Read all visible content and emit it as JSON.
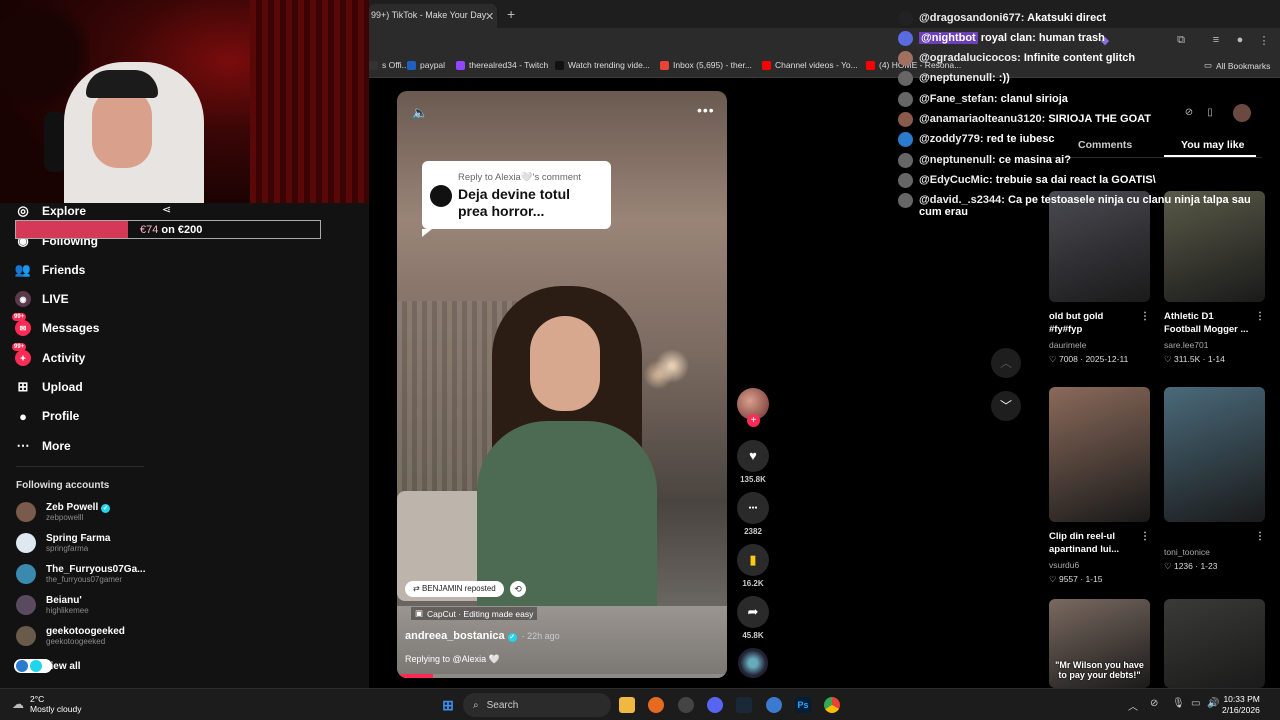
{
  "browser": {
    "tab_title": "99+) TikTok - Make Your Day",
    "tab_close": "✕",
    "new_tab": "+",
    "bookmarks": [
      {
        "label": "s Offi...",
        "color": "#333333"
      },
      {
        "label": "paypal",
        "color": "#1f5fbf"
      },
      {
        "label": "therealred34 - Twitch",
        "color": "#9146ff"
      },
      {
        "label": "Watch trending vide...",
        "color": "#111111"
      },
      {
        "label": "Inbox (5,695) - ther...",
        "color": "#ea4335"
      },
      {
        "label": "Channel videos - Yo...",
        "color": "#ff0000"
      },
      {
        "label": "(4) HOME - Resona...",
        "color": "#ff0000"
      }
    ],
    "all_bookmarks": "All Bookmarks"
  },
  "sidebar": {
    "donation": {
      "prefix": "€74",
      "suffix": " on €200",
      "progress": 0.37
    },
    "nav": [
      {
        "label": "Explore",
        "icon": "compass-icon",
        "glyph": "◎",
        "badge": ""
      },
      {
        "label": "Following",
        "icon": "following-icon",
        "glyph": "◉",
        "badge": ""
      },
      {
        "label": "Friends",
        "icon": "friends-icon",
        "glyph": "👥",
        "badge": ""
      },
      {
        "label": "LIVE",
        "icon": "live-icon",
        "glyph": "◉",
        "badge": ""
      },
      {
        "label": "Messages",
        "icon": "messages-icon",
        "glyph": "✉",
        "badge": "99+"
      },
      {
        "label": "Activity",
        "icon": "activity-icon",
        "glyph": "✦",
        "badge": "99+"
      },
      {
        "label": "Upload",
        "icon": "upload-icon",
        "glyph": "⊞",
        "badge": ""
      },
      {
        "label": "Profile",
        "icon": "profile-icon",
        "glyph": "●",
        "badge": ""
      },
      {
        "label": "More",
        "icon": "more-icon",
        "glyph": "⋯",
        "badge": ""
      }
    ],
    "following_title": "Following accounts",
    "accounts": [
      {
        "name": "Zeb Powell",
        "handle": "zebpowelll",
        "verified": true,
        "color": "#7a5a4a"
      },
      {
        "name": "Spring Farma",
        "handle": "springfarma",
        "verified": false,
        "color": "#dfe8f0"
      },
      {
        "name": "The_Furryous07Ga...",
        "handle": "the_furryous07gamer",
        "verified": false,
        "color": "#3a8ab0"
      },
      {
        "name": "Beianu'",
        "handle": "highlikemee",
        "verified": false,
        "color": "#5a4a60"
      },
      {
        "name": "geekotoogeeked",
        "handle": "geekotoogeeked",
        "verified": false,
        "color": "#6a5a4a"
      }
    ],
    "view_all": "View all"
  },
  "video": {
    "reply_label": "Reply to Alexia🤍's comment",
    "reply_line1": "Deja devine totul",
    "reply_line2": "prea horror...",
    "repost": "BENJAMIN reposted",
    "capcut": "CapCut · Editing made easy",
    "author": "andreea_bostanica",
    "ago": "· 22h ago",
    "replying": "Replying to @Alexia 🤍",
    "progress": 0.11
  },
  "actions": [
    {
      "name": "like",
      "icon": "heart-icon",
      "glyph": "♥",
      "count": "135.8K"
    },
    {
      "name": "comment",
      "icon": "comment-icon",
      "glyph": "●●●",
      "count": "2382"
    },
    {
      "name": "bookmark",
      "icon": "bookmark-icon",
      "glyph": "▮",
      "count": "16.2K"
    },
    {
      "name": "share",
      "icon": "share-icon",
      "glyph": "➦",
      "count": "45.8K"
    }
  ],
  "right_panel": {
    "tabs": [
      "Comments",
      "You may like"
    ],
    "active_tab": 1,
    "cards": [
      {
        "title": "old but gold #fy#fyp",
        "user": "daurimele",
        "stats": "♡ 7008 · 2025-12-11",
        "caption": "",
        "bg": "#4a4a52"
      },
      {
        "title": "Athletic D1 Football Mogger ...",
        "user": "sare.lee701",
        "stats": "♡ 311.5K · 1-14",
        "caption": "",
        "bg": "#5a5a48"
      },
      {
        "title": "Clip din reel-ul apartinand lui...",
        "user": "vsurdu6",
        "stats": "♡ 9557 · 1-15",
        "caption": "",
        "bg": "#8a6a5a"
      },
      {
        "title": "",
        "user": "toni_toonice",
        "stats": "♡ 1236 · 1-23",
        "caption": "",
        "bg": "#4a6a7a"
      },
      {
        "title": "",
        "user": "",
        "stats": "",
        "caption": "\"Mr Wilson you have to pay your debts!\"",
        "bg": "#7a6a60"
      },
      {
        "title": "",
        "user": "",
        "stats": "",
        "caption": "",
        "bg": "#3a3a38"
      }
    ]
  },
  "chat": [
    {
      "user": "@dragosandoni677:",
      "msg": "Akatsuki direct",
      "hl": false,
      "color": "#222222"
    },
    {
      "user": "@nightbot",
      "msg": "royal clan: human trash",
      "hl": true,
      "color": "#5a6adf"
    },
    {
      "user": "@ogradalucicocos:",
      "msg": "Infinite content glitch",
      "hl": false,
      "color": "#a07060"
    },
    {
      "user": "@neptunenull:",
      "msg": ":))",
      "hl": false,
      "color": "#666666"
    },
    {
      "user": "@Fane_stefan:",
      "msg": "clanul sirioja",
      "hl": false,
      "color": "#666666"
    },
    {
      "user": "@anamariaolteanu3120:",
      "msg": "SIRIOJA THE GOAT",
      "hl": false,
      "color": "#8a5a4a"
    },
    {
      "user": "@zoddy779:",
      "msg": "red te iubesc",
      "hl": false,
      "color": "#2a7acd"
    },
    {
      "user": "@neptunenull:",
      "msg": "ce masina ai?",
      "hl": false,
      "color": "#666666"
    },
    {
      "user": "@EdyCucMic:",
      "msg": "trebuie sa dai react la GOATIS\\",
      "hl": false,
      "color": "#666666"
    },
    {
      "user": "@david._.s2344:",
      "msg": "Ca pe testoasele ninja cu clanu ninja talpa sau",
      "msg2": "cum erau",
      "hl": false,
      "color": "#666666"
    }
  ],
  "taskbar": {
    "temp": "2°C",
    "condition": "Mostly cloudy",
    "search": "Search",
    "time": "10:33 PM",
    "date": "2/16/2026"
  }
}
